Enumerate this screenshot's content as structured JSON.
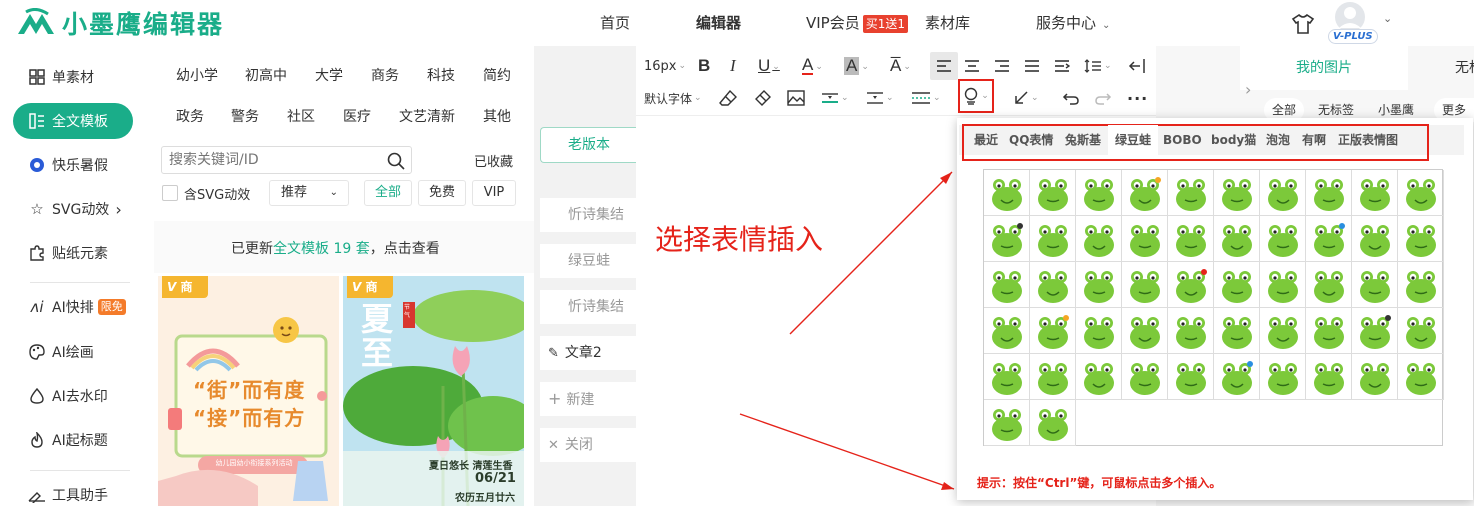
{
  "header": {
    "logo_text": "小墨鹰编辑器",
    "nav": [
      "首页",
      "编辑器",
      "VIP会员",
      "素材库",
      "服务中心"
    ],
    "vip_badge": "买1送1",
    "avatar_badge": "V-PLUS"
  },
  "sidebar": {
    "items": [
      {
        "label": "单素材",
        "icon": "grid-icon"
      },
      {
        "label": "全文模板",
        "icon": "template-icon",
        "active": true
      },
      {
        "label": "快乐暑假",
        "icon": "ball-icon"
      },
      {
        "label": "SVG动效",
        "icon": "star-icon"
      },
      {
        "label": "贴纸元素",
        "icon": "puzzle-icon"
      },
      {
        "label": "AI快排",
        "icon": "ai-icon",
        "badge": "限免"
      },
      {
        "label": "AI绘画",
        "icon": "palette-icon"
      },
      {
        "label": "AI去水印",
        "icon": "drop-icon"
      },
      {
        "label": "AI起标题",
        "icon": "flame-icon"
      },
      {
        "label": "工具助手",
        "icon": "tools-icon"
      }
    ],
    "svg_arrow": "›"
  },
  "categories": {
    "row1": [
      "幼小学",
      "初高中",
      "大学",
      "商务",
      "科技",
      "简约"
    ],
    "row2": [
      "政务",
      "警务",
      "社区",
      "医疗",
      "文艺清新",
      "其他"
    ],
    "search_placeholder": "搜索关键词/ID",
    "favorites": "已收藏",
    "svg_checkbox": "含SVG动效",
    "sort": "推荐",
    "filters": [
      "全部",
      "免费",
      "VIP"
    ],
    "update_prefix": "已更新",
    "update_link": "全文模板 19 套",
    "update_suffix": "，点击查看"
  },
  "thumbs": [
    {
      "tag": "商",
      "title1": "“街”而有度",
      "title2": "“接”而有方",
      "ribbon": "幼儿园幼小衔接系列活动"
    },
    {
      "tag": "商",
      "big": "夏至",
      "seal": "节气",
      "line1": "夏日悠长 清莲生香",
      "date": "06/21",
      "lunar": "农历五月廿六"
    }
  ],
  "docs": {
    "old_version": "老版本",
    "items": [
      "忻诗集结",
      "绿豆蛙",
      "忻诗集结",
      "文章2"
    ],
    "new": "新建",
    "close": "关闭"
  },
  "toolbar": {
    "font_size": "16px",
    "font_family": "默认字体"
  },
  "emoji_popup": {
    "tabs": [
      "最近",
      "QQ表情",
      "兔斯基",
      "绿豆蛙",
      "BOBO",
      "body猫",
      "泡泡",
      "有啊",
      "正版表情图"
    ],
    "active_tab": "绿豆蛙",
    "emoji_count": 52,
    "hint": "提示：按住“Ctrl”键，可鼠标点击多个插入。"
  },
  "annotation": "选择表情插入",
  "right_panel": {
    "tabs": [
      "我的图片",
      "无标"
    ],
    "chips": [
      "全部",
      "无标签",
      "小墨鹰",
      "更多"
    ]
  },
  "colors": {
    "brand": "#1aad89",
    "annotation": "#e5231a",
    "frog": "#7cc93a"
  }
}
